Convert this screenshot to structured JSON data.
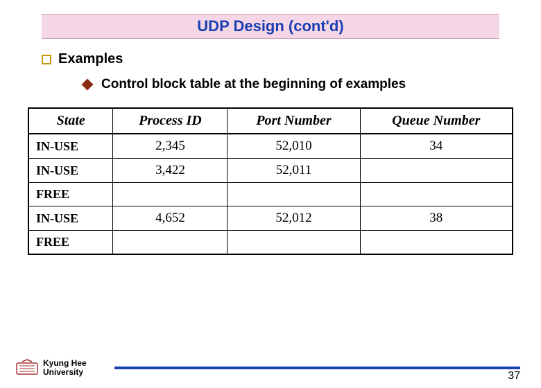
{
  "title": "UDP Design (cont'd)",
  "bullet_main": "Examples",
  "bullet_sub": "Control block table at the beginning of examples",
  "table": {
    "headers": [
      "State",
      "Process ID",
      "Port Number",
      "Queue Number"
    ],
    "rows": [
      {
        "state": "IN-USE",
        "pid": "2,345",
        "port": "52,010",
        "queue": "34"
      },
      {
        "state": "IN-USE",
        "pid": "3,422",
        "port": "52,011",
        "queue": ""
      },
      {
        "state": "FREE",
        "pid": "",
        "port": "",
        "queue": ""
      },
      {
        "state": "IN-USE",
        "pid": "4,652",
        "port": "52,012",
        "queue": "38"
      },
      {
        "state": "FREE",
        "pid": "",
        "port": "",
        "queue": ""
      }
    ]
  },
  "footer": {
    "university_line1": "Kyung Hee",
    "university_line2": "University",
    "page": "37"
  }
}
